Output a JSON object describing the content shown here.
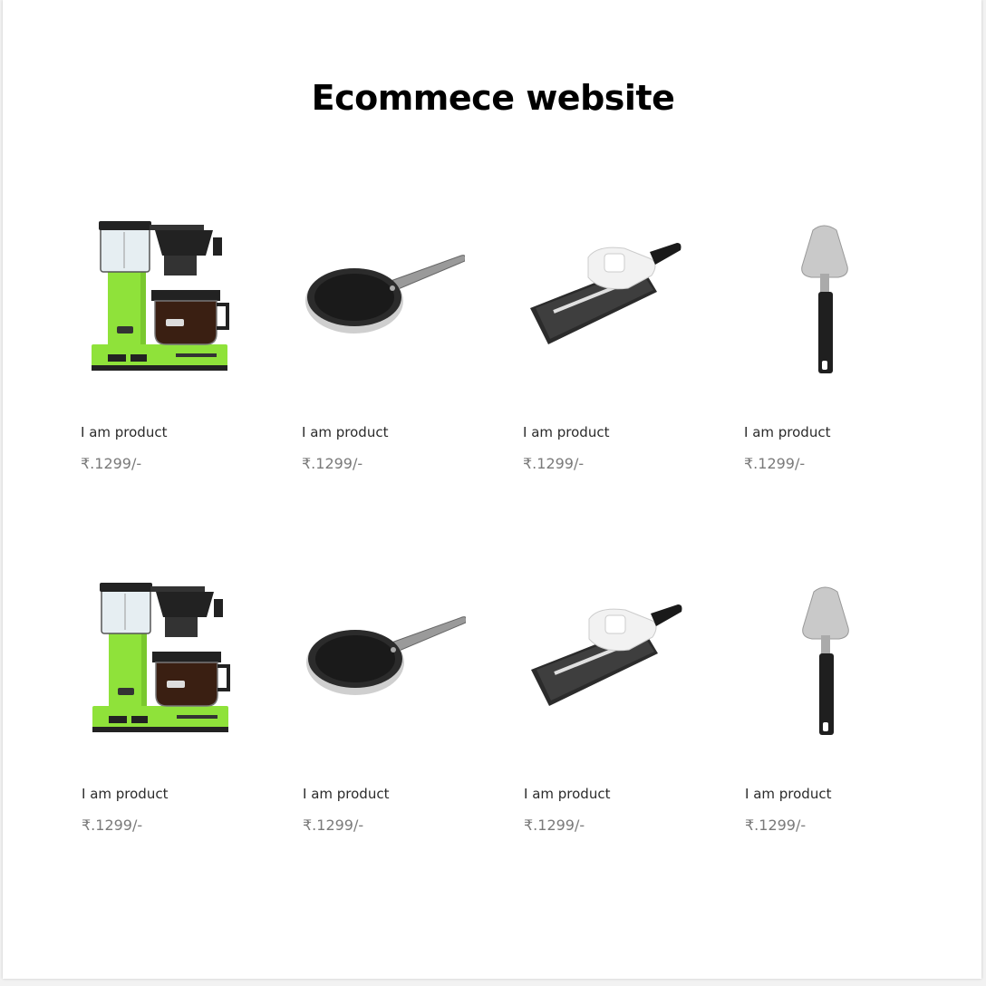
{
  "page": {
    "title": "Ecommece website"
  },
  "products": [
    {
      "name": "I am product",
      "price": "₹.1299/-",
      "image": "coffee-maker",
      "color": "#8fe23a"
    },
    {
      "name": "I am product",
      "price": "₹.1299/-",
      "image": "frying-pan"
    },
    {
      "name": "I am product",
      "price": "₹.1299/-",
      "image": "mandoline-slicer"
    },
    {
      "name": "I am product",
      "price": "₹.1299/-",
      "image": "cheese-slicer"
    },
    {
      "name": "I am product",
      "price": "₹.1299/-",
      "image": "coffee-maker",
      "color": "#8fe23a"
    },
    {
      "name": "I am product",
      "price": "₹.1299/-",
      "image": "frying-pan"
    },
    {
      "name": "I am product",
      "price": "₹.1299/-",
      "image": "mandoline-slicer"
    },
    {
      "name": "I am product",
      "price": "₹.1299/-",
      "image": "cheese-slicer"
    }
  ]
}
